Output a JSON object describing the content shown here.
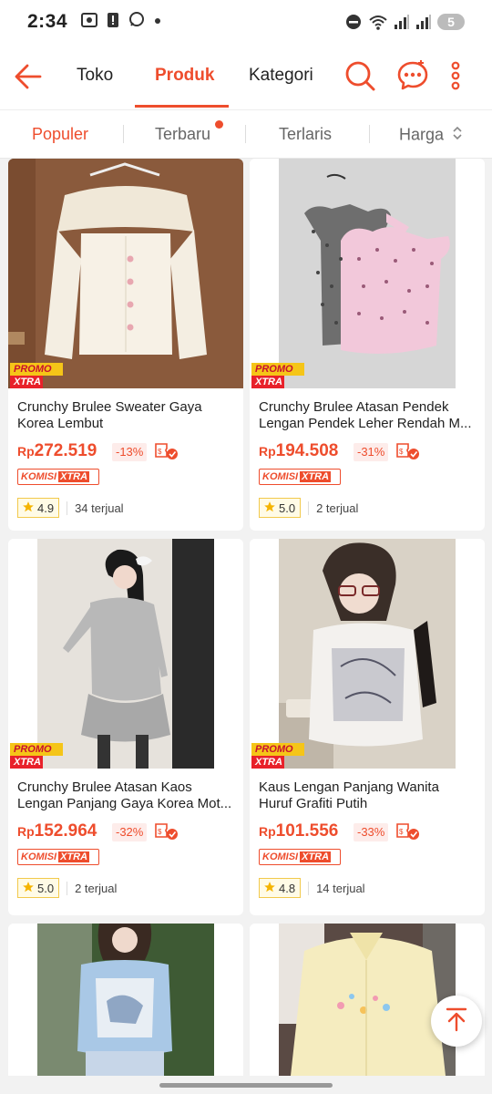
{
  "status_bar": {
    "time": "2:34",
    "battery_level": "5"
  },
  "header": {
    "tabs": [
      {
        "label": "Toko",
        "active": false
      },
      {
        "label": "Produk",
        "active": true
      },
      {
        "label": "Kategori",
        "active": false
      }
    ],
    "icons": [
      "back-arrow-icon",
      "search-icon",
      "chat-icon",
      "more-vertical-icon"
    ]
  },
  "sort_bar": {
    "items": [
      {
        "label": "Populer",
        "active": true
      },
      {
        "label": "Terbaru",
        "active": false,
        "dot": true
      },
      {
        "label": "Terlaris",
        "active": false
      },
      {
        "label": "Harga",
        "active": false
      }
    ]
  },
  "badges": {
    "promo_top": "PROMO",
    "promo_bottom": "XTRA",
    "komisi": "KOMISI",
    "komisi_xtra": "XTRA",
    "currency": "Rp"
  },
  "products": [
    {
      "title_line1": "Crunchy Brulee Sweater Gaya",
      "title_line2": "Korea Lembut",
      "price": "272.519",
      "discount": "-13%",
      "rating": "4.9",
      "sold": "34 terjual"
    },
    {
      "title_line1": "Crunchy Brulee Atasan Pendek",
      "title_line2": "Lengan Pendek Leher Rendah M...",
      "price": "194.508",
      "discount": "-31%",
      "rating": "5.0",
      "sold": "2 terjual"
    },
    {
      "title_line1": "Crunchy Brulee Atasan Kaos",
      "title_line2": "Lengan Panjang Gaya Korea Mot...",
      "price": "152.964",
      "discount": "-32%",
      "rating": "5.0",
      "sold": "2 terjual"
    },
    {
      "title_line1": "Kaus Lengan Panjang Wanita",
      "title_line2": "Huruf Grafiti Putih",
      "price": "101.556",
      "discount": "-33%",
      "rating": "4.8",
      "sold": "14 terjual"
    },
    {
      "title_line1": "",
      "title_line2": "",
      "price": "",
      "discount": "",
      "rating": "",
      "sold": ""
    },
    {
      "title_line1": "",
      "title_line2": "",
      "price": "",
      "discount": "",
      "rating": "",
      "sold": ""
    }
  ],
  "colors": {
    "accent": "#ee4d2d",
    "promo_yellow": "#f5c518",
    "promo_red": "#e8212a"
  }
}
